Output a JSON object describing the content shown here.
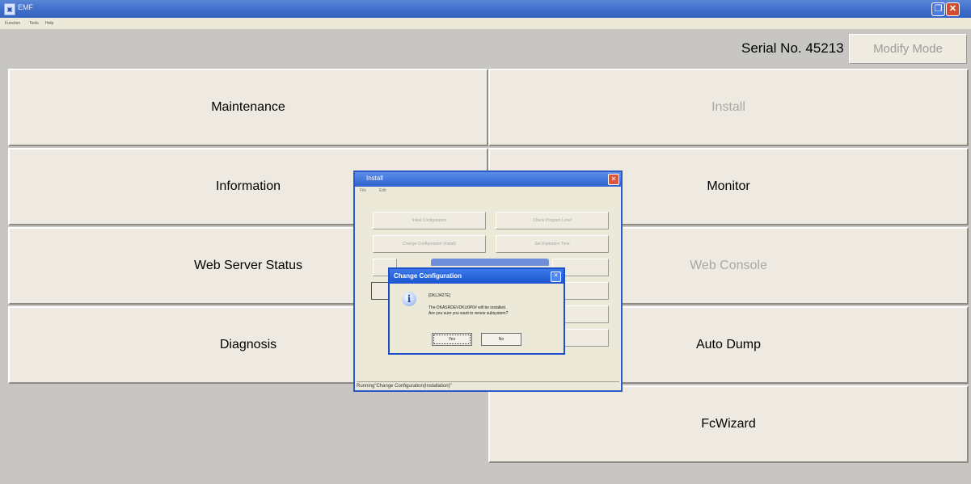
{
  "window": {
    "title": "EMF",
    "menu": [
      "Function",
      "Tools",
      "Help"
    ]
  },
  "header": {
    "serial": "Serial No. 45213",
    "modify_label": "Modify Mode"
  },
  "buttons": {
    "maintenance": "Maintenance",
    "install": "Install",
    "information": "Information",
    "monitor": "Monitor",
    "web_server_status": "Web Server Status",
    "web_console": "Web Console",
    "diagnosis": "Diagnosis",
    "auto_dump": "Auto Dump",
    "fcwizard": "FcWizard"
  },
  "install_window": {
    "title": "Install",
    "menu": [
      "File",
      "Edit"
    ],
    "buttons": [
      "Initial Configuration",
      "Check Program Level",
      "Change Configuration (Install)",
      "Set Expiration Time"
    ],
    "status": "Running\"Change Configuration(Installation)\""
  },
  "dialog": {
    "title": "Change Configuration",
    "line1": "[DKL3427E]",
    "line2": "The DKASRDEVDKU0P0# will be installed.",
    "line3": "Are you sure you want to renew subsystem?",
    "yes": "Yes",
    "no": "No"
  },
  "colors": {
    "title_blue": "#3d6cc8",
    "button_face": "#eeeae1",
    "background": "#c8c6c3",
    "close_red": "#d24b32"
  }
}
